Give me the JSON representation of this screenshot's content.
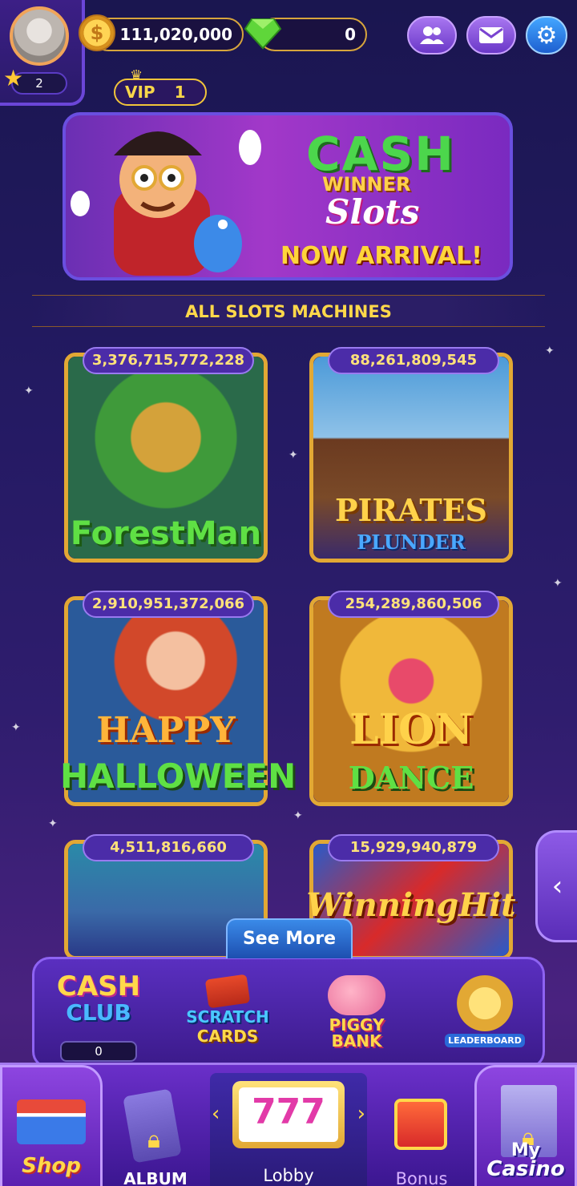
{
  "header": {
    "coins": "111,020,000",
    "gems": "0",
    "level": "2",
    "vip_label": "VIP",
    "vip_level": "1"
  },
  "banner": {
    "title_cash": "CASH",
    "title_winner": "WINNER",
    "title_slots": "Slots",
    "tagline": "NOW ARRIVAL!"
  },
  "section_title": "ALL SLOTS MACHINES",
  "slots": [
    {
      "jackpot": "3,376,715,772,228",
      "name": "ForestMan"
    },
    {
      "jackpot": "88,261,809,545",
      "name": "PIRATES",
      "name2": "PLUNDER"
    },
    {
      "jackpot": "2,910,951,372,066",
      "name": "HAPPY",
      "name2": "HALLOWEEN"
    },
    {
      "jackpot": "254,289,860,506",
      "name": "LION",
      "name2": "DANCE"
    },
    {
      "jackpot": "4,511,816,660",
      "name": ""
    },
    {
      "jackpot": "15,929,940,879",
      "name": "WinningHit"
    }
  ],
  "see_more": "See More",
  "features": {
    "cash_club_1": "CASH",
    "cash_club_2": "CLUB",
    "cash_club_count": "0",
    "scratch_1": "SCRATCH",
    "scratch_2": "CARDS",
    "piggy_1": "PIGGY",
    "piggy_2": "BANK",
    "leaderboard": "LEADERBOARD"
  },
  "nav": {
    "shop": "Shop",
    "album": "ALBUM",
    "lobby": "Lobby",
    "bonus": "Bonus",
    "my_casino_1": "My",
    "my_casino_2": "Casino"
  },
  "colors": {
    "gold_border": "#e2a834",
    "accent_purple": "#8e63f2",
    "jackpot_text": "#ffe27a"
  }
}
